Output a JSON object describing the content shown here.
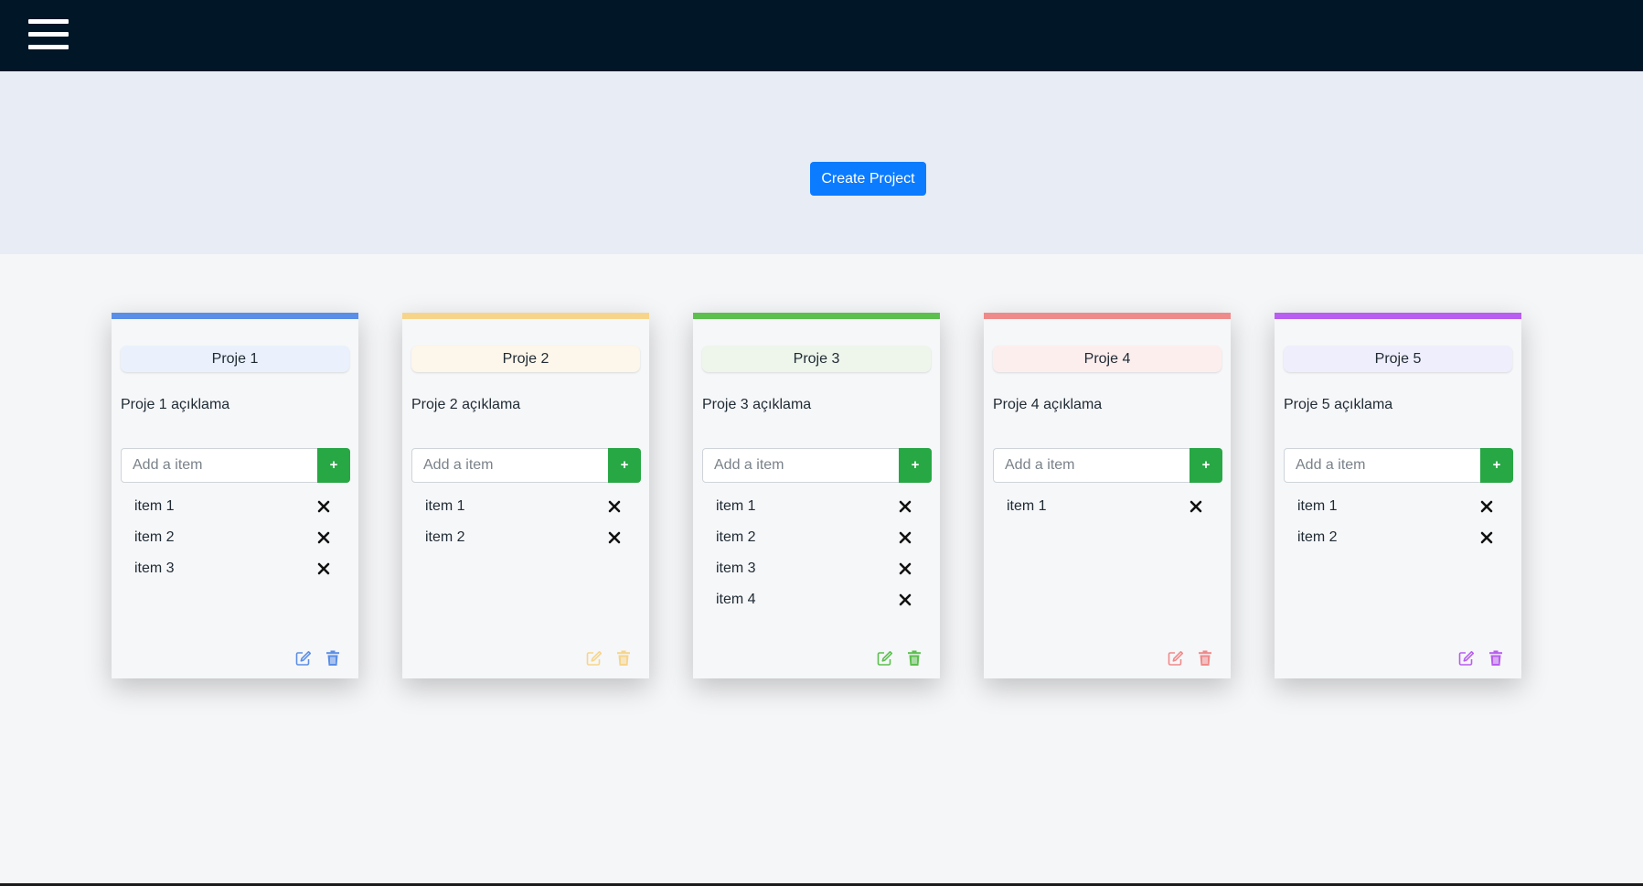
{
  "navbar": {
    "menu_icon": "hamburger-menu-icon"
  },
  "hero": {
    "create_label": "Create Project"
  },
  "add_placeholder": "Add a item",
  "add_label": "+",
  "projects": [
    {
      "title": "Proje 1",
      "description": "Proje 1 açıklama",
      "color": "#5b8ee6",
      "tint": "#eaf1fc",
      "items": [
        "item 1",
        "item 2",
        "item 3"
      ]
    },
    {
      "title": "Proje 2",
      "description": "Proje 2 açıklama",
      "color": "#f6d58b",
      "tint": "#fdf6ea",
      "items": [
        "item 1",
        "item 2"
      ]
    },
    {
      "title": "Proje 3",
      "description": "Proje 3 açıklama",
      "color": "#5cbf4e",
      "tint": "#eef6ec",
      "items": [
        "item 1",
        "item 2",
        "item 3",
        "item 4"
      ]
    },
    {
      "title": "Proje 4",
      "description": "Proje 4 açıklama",
      "color": "#ef8a8a",
      "tint": "#fdeeee",
      "items": [
        "item 1"
      ]
    },
    {
      "title": "Proje 5",
      "description": "Proje 5 açıklama",
      "color": "#b85ef0",
      "tint": "#efeefc",
      "items": [
        "item 1",
        "item 2"
      ]
    }
  ],
  "icons": {
    "remove": "close-icon",
    "edit": "edit-icon",
    "delete": "trash-icon"
  }
}
